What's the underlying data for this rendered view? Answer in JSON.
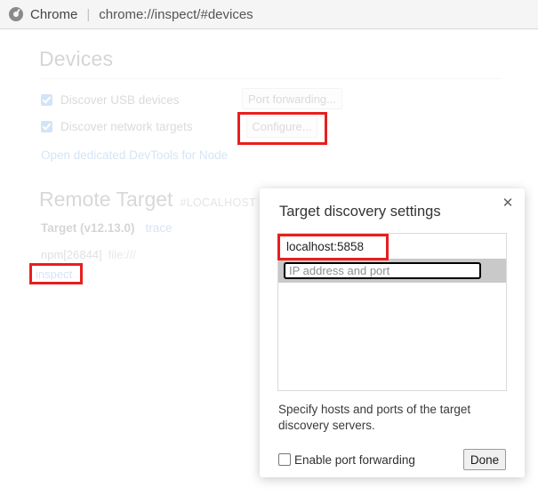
{
  "topbar": {
    "icon": "chrome-logo-icon",
    "app_label": "Chrome",
    "separator": "|",
    "url": "chrome://inspect/#devices"
  },
  "devices": {
    "heading": "Devices",
    "discover_usb": {
      "label": "Discover USB devices",
      "checked": true
    },
    "discover_network": {
      "label": "Discover network targets",
      "checked": true
    },
    "port_forwarding_button": "Port forwarding...",
    "configure_button": "Configure...",
    "node_devtools_link": "Open dedicated DevTools for Node"
  },
  "remote_target": {
    "heading": "Remote Target",
    "host_tag": "#LOCALHOST",
    "target_name": "Target (v12.13.0)",
    "trace_link": "trace",
    "process": "npm[26844]",
    "file_url": "file:///",
    "inspect_link": "inspect"
  },
  "dialog": {
    "title": "Target discovery settings",
    "close_icon": "close-icon",
    "hosts": [
      {
        "value": "localhost:5858",
        "editing": false
      }
    ],
    "new_host_input": {
      "value": "",
      "placeholder": "IP address and port"
    },
    "hint": "Specify hosts and ports of the target discovery servers.",
    "enable_port_forwarding": {
      "label": "Enable port forwarding",
      "checked": false
    },
    "done_button": "Done"
  },
  "annotations": {
    "accent_color": "#e81e1e",
    "boxes": [
      {
        "target": "configure-button"
      },
      {
        "target": "inspect-link"
      },
      {
        "target": "localhost-host-row"
      }
    ]
  }
}
